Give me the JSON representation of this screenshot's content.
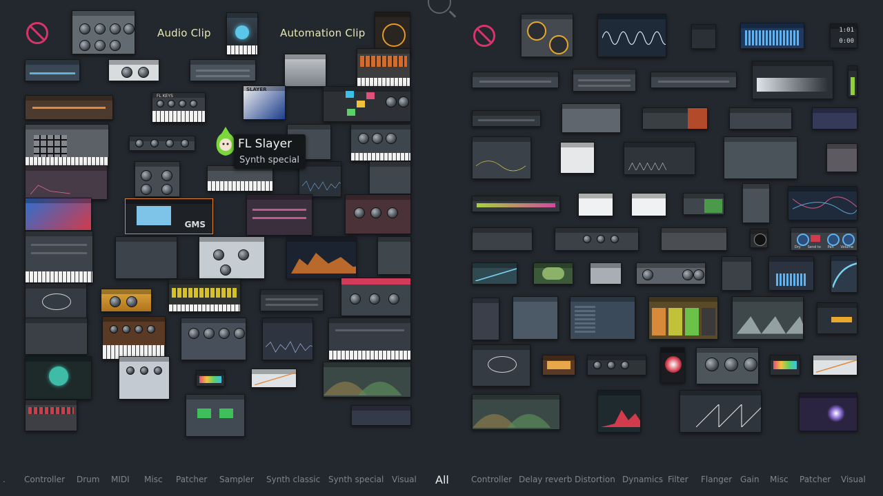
{
  "left_panel": {
    "labels": {
      "audio_clip": "Audio Clip",
      "automation_clip": "Automation Clip"
    },
    "tooltip": {
      "title": "FL Slayer",
      "subtitle": "Synth special"
    },
    "brand_texts": {
      "gms": "GMS",
      "fl_keys": "FL KEYS",
      "slayer": "SLAYER"
    }
  },
  "right_panel": {
    "timecode": [
      "1:01",
      "0:00"
    ],
    "knob_labels": [
      "Dry",
      "Send to",
      "Pan",
      "Volume"
    ]
  },
  "footer": {
    "left_categories": [
      ".",
      "Controller",
      "Drum",
      "MIDI",
      "Misc",
      "Patcher",
      "Sampler",
      "Synth classic",
      "Synth special",
      "Visual"
    ],
    "active_category": "All",
    "right_categories": [
      "Controller",
      "Delay reverb",
      "Distortion",
      "Dynamics",
      "Filter",
      "Flanger",
      "Gain",
      "Misc",
      "Patcher",
      "Visual"
    ]
  },
  "colors": {
    "background": "#23282e",
    "disabled_icon": "#d8346a",
    "clip_label": "#e6e8b0",
    "active_tab": "#f0f0f0",
    "inactive_tab": "#7d858d"
  }
}
